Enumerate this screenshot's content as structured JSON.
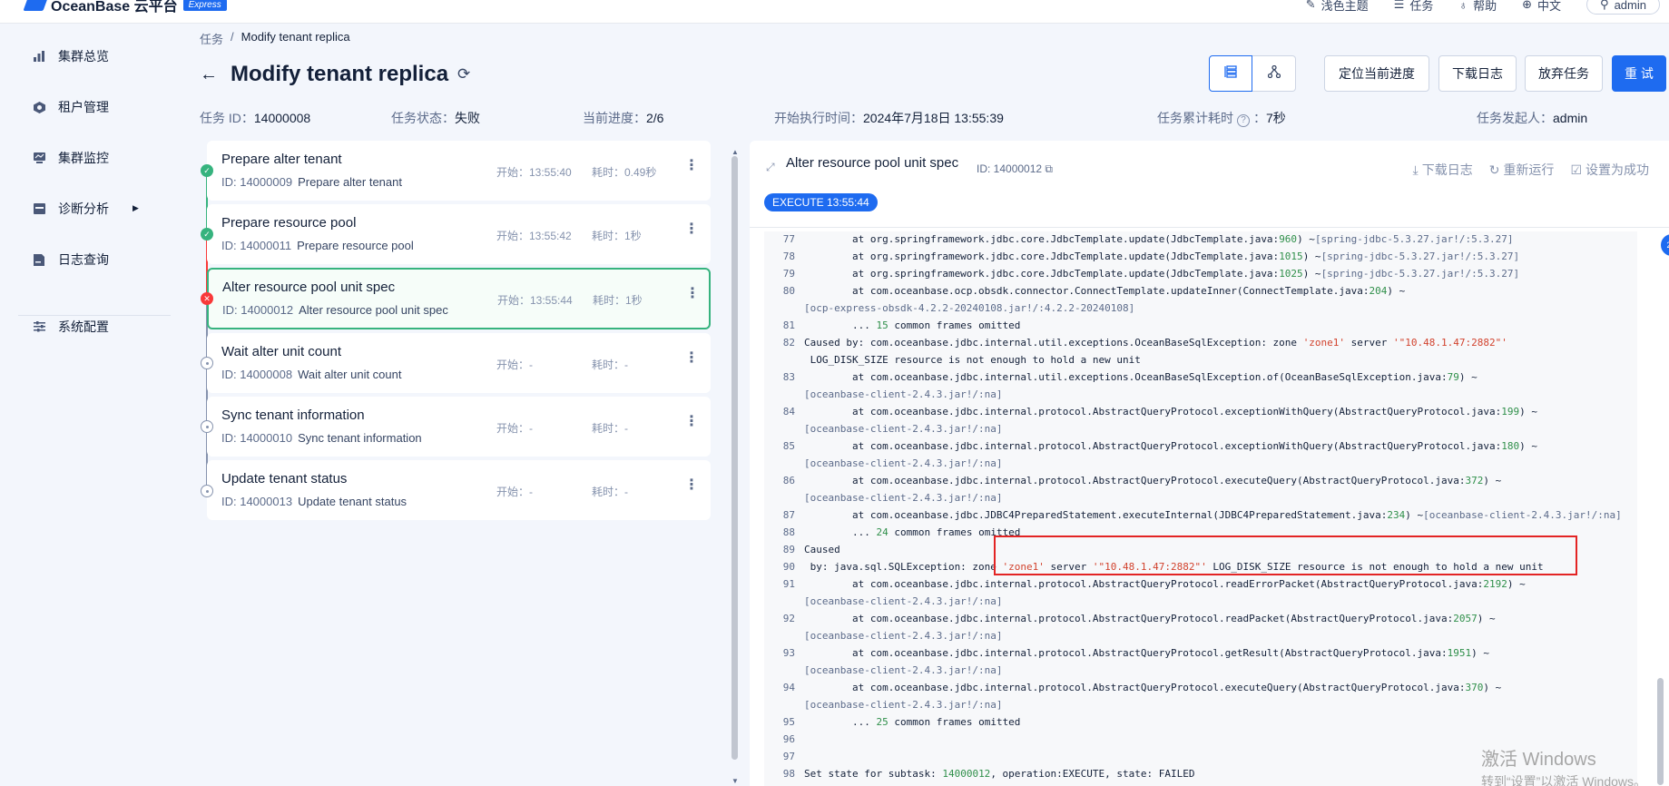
{
  "brand": {
    "name": "OceanBase 云平台",
    "badge": "Express"
  },
  "topbar": {
    "theme": "浅色主题",
    "tasks": "任务",
    "help": "帮助",
    "language": "中文",
    "user": "admin"
  },
  "sidebar": {
    "items": [
      {
        "label": "集群总览",
        "icon": "bar-chart-icon"
      },
      {
        "label": "租户管理",
        "icon": "tenant-icon"
      },
      {
        "label": "集群监控",
        "icon": "monitor-icon"
      },
      {
        "label": "诊断分析",
        "icon": "diagnose-icon"
      },
      {
        "label": "日志查询",
        "icon": "log-icon"
      },
      {
        "label": "系统配置",
        "icon": "settings-sliders-icon"
      }
    ]
  },
  "breadcrumb": {
    "root": "任务",
    "sep": "/",
    "current": "Modify tenant replica"
  },
  "header": {
    "title": "Modify tenant replica",
    "buttons": {
      "locate": "定位当前进度",
      "download": "下载日志",
      "abandon": "放弃任务",
      "retry": "重 试"
    }
  },
  "meta": {
    "task_id_label": "任务 ID：",
    "task_id": "14000008",
    "status_label": "任务状态：",
    "status": "失败",
    "progress_label": "当前进度：",
    "progress": "2/6",
    "start_label": "开始执行时间：",
    "start": "2024年7月18日 13:55:39",
    "elapsed_label": "任务累计耗时",
    "elapsed": "7秒",
    "initiator_label": "任务发起人：",
    "initiator": "admin"
  },
  "tasks": [
    {
      "name": "Prepare alter tenant",
      "id": "ID: 14000009",
      "sub": "Prepare alter tenant",
      "start": "开始：13:55:40",
      "cost": "耗时：0.49秒",
      "status": "success"
    },
    {
      "name": "Prepare resource pool",
      "id": "ID: 14000011",
      "sub": "Prepare resource pool",
      "start": "开始：13:55:42",
      "cost": "耗时：1秒",
      "status": "success"
    },
    {
      "name": "Alter resource pool unit spec",
      "id": "ID: 14000012",
      "sub": "Alter resource pool unit spec",
      "start": "开始：13:55:44",
      "cost": "耗时：1秒",
      "status": "failed"
    },
    {
      "name": "Wait alter unit count",
      "id": "ID: 14000008",
      "sub": "Wait alter unit count",
      "start": "开始：-",
      "cost": "耗时：-",
      "status": "pending"
    },
    {
      "name": "Sync tenant information",
      "id": "ID: 14000010",
      "sub": "Sync tenant information",
      "start": "开始：-",
      "cost": "耗时：-",
      "status": "pending"
    },
    {
      "name": "Update tenant status",
      "id": "ID: 14000013",
      "sub": "Update tenant status",
      "start": "开始：-",
      "cost": "耗时：-",
      "status": "pending"
    }
  ],
  "log_panel": {
    "title": "Alter resource pool unit spec",
    "id": "ID: 14000012",
    "actions": {
      "download": "下载日志",
      "rerun": "重新运行",
      "set_success": "设置为成功"
    },
    "exec_tag": "EXECUTE 13:55:44"
  },
  "colors": {
    "primary": "#1e6bf0",
    "success": "#36b37e",
    "danger": "#f93939",
    "highlight_box": "#e32424"
  },
  "watermark": {
    "line1": "激活 Windows",
    "line2": "转到“设置”以激活 Windows。"
  }
}
